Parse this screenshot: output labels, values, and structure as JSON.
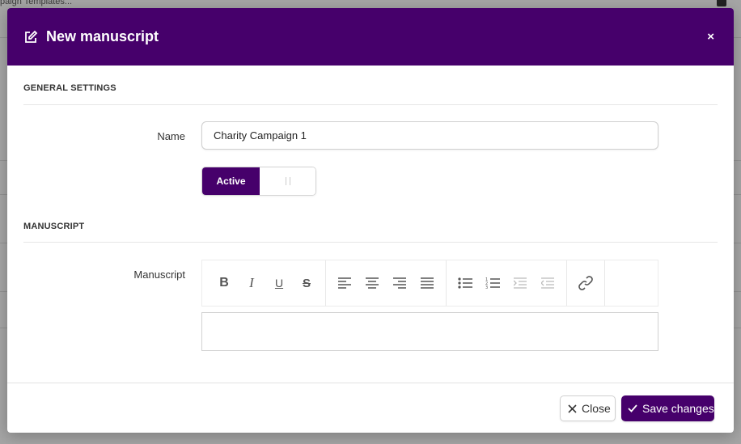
{
  "background": {
    "breadcrumb": "paign Templates..."
  },
  "modal": {
    "title": "New manuscript",
    "close_symbol": "×",
    "accent_color": "#46006b",
    "general_settings": {
      "heading": "GENERAL SETTINGS",
      "name_label": "Name",
      "name_value": "Charity Campaign 1",
      "toggle_on_label": "Active"
    },
    "manuscript": {
      "heading": "MANUSCRIPT",
      "label": "Manuscript",
      "toolbar": {
        "bold": "B",
        "italic": "I",
        "underline": "U",
        "strikethrough": "S",
        "icons": [
          "align-left-icon",
          "align-center-icon",
          "align-right-icon",
          "align-justify-icon",
          "bullet-list-icon",
          "numbered-list-icon",
          "indent-icon",
          "outdent-icon",
          "link-icon"
        ]
      },
      "content": ""
    },
    "footer": {
      "close_label": "Close",
      "save_label": "Save changes"
    }
  }
}
